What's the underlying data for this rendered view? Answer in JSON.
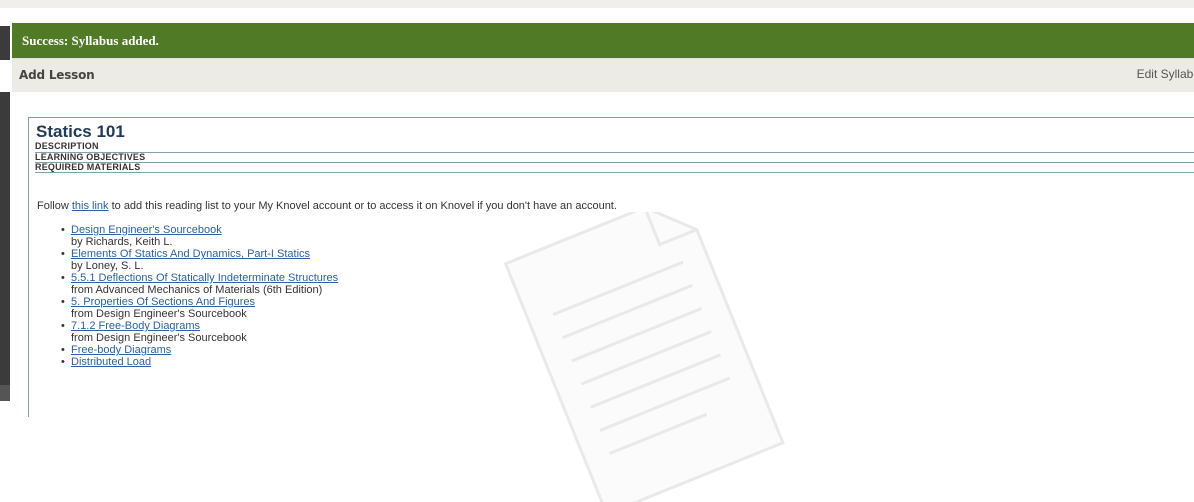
{
  "alert": {
    "message": "Success: Syllabus added."
  },
  "actions": {
    "add_lesson": "Add Lesson",
    "edit_syllabus": "Edit Syllabu"
  },
  "syllabus": {
    "title": "Statics 101",
    "sections": [
      "DESCRIPTION",
      "LEARNING OBJECTIVES",
      "REQUIRED MATERIALS"
    ],
    "follow_prefix": "Follow ",
    "follow_link": "this link",
    "follow_suffix": " to add this reading list to your My Knovel account or to access it on Knovel if you don't have an account.",
    "items": [
      {
        "title": "Design Engineer's Sourcebook",
        "sub": "by Richards, Keith L."
      },
      {
        "title": "Elements Of Statics And Dynamics, Part-I Statics",
        "sub": "by Loney, S. L."
      },
      {
        "title": "5.5.1 Deflections Of Statically Indeterminate Structures",
        "sub": "from Advanced Mechanics of Materials (6th Edition)"
      },
      {
        "title": "5. Properties Of Sections And Figures",
        "sub": "from Design Engineer's Sourcebook"
      },
      {
        "title": "7.1.2 Free-Body Diagrams",
        "sub": "from Design Engineer's Sourcebook"
      },
      {
        "title": "Free-body Diagrams",
        "sub": ""
      },
      {
        "title": "Distributed Load",
        "sub": ""
      }
    ]
  },
  "icons": {
    "watermark": "document-icon",
    "bullet": "bullet-dot"
  },
  "colors": {
    "success": "#517a27",
    "link": "#2b5fa8",
    "border": "#7fa3a8"
  }
}
